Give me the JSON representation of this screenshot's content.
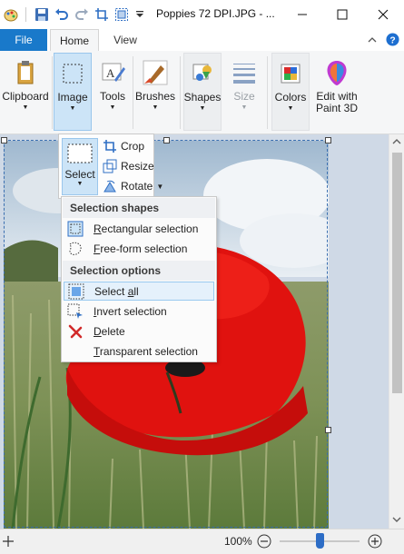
{
  "window": {
    "title": "Poppies 72 DPI.JPG - ...",
    "minimize_icon": "minimize-icon",
    "maximize_icon": "maximize-icon",
    "close_icon": "close-icon"
  },
  "quick_access": [
    "paint-app-icon",
    "save-icon",
    "undo-icon",
    "redo-icon",
    "crop-qat-icon",
    "select-qat-icon",
    "customize-qat-icon"
  ],
  "tabs": {
    "file": "File",
    "home": "Home",
    "view": "View"
  },
  "ribbon": {
    "clipboard": "Clipboard",
    "image": "Image",
    "tools": "Tools",
    "brushes": "Brushes",
    "shapes": "Shapes",
    "size": "Size",
    "colors": "Colors",
    "edit_paint3d_line1": "Edit with",
    "edit_paint3d_line2": "Paint 3D"
  },
  "image_menu": {
    "select": "Select",
    "crop": "Crop",
    "resize": "Resize",
    "rotate": "Rotate"
  },
  "select_menu": {
    "header_shapes": "Selection shapes",
    "rectangular_pre": "",
    "rectangular_ul": "R",
    "rectangular_post": "ectangular selection",
    "freeform_pre": "",
    "freeform_ul": "F",
    "freeform_post": "ree-form selection",
    "header_options": "Selection options",
    "select_all_pre": "Select ",
    "select_all_ul": "a",
    "select_all_post": "ll",
    "invert_pre": "",
    "invert_ul": "I",
    "invert_post": "nvert selection",
    "delete_pre": "",
    "delete_ul": "D",
    "delete_post": "elete",
    "transparent_pre": "",
    "transparent_ul": "T",
    "transparent_post": "ransparent selection"
  },
  "status": {
    "zoom": "100%",
    "zoom_slider_fraction": 0.5
  },
  "colors": {
    "file_tab": "#1979ca",
    "ribbon_bg": "#f5f6f7",
    "canvas_bg": "#cfd9e6",
    "poppy_red": "#e0120f"
  }
}
